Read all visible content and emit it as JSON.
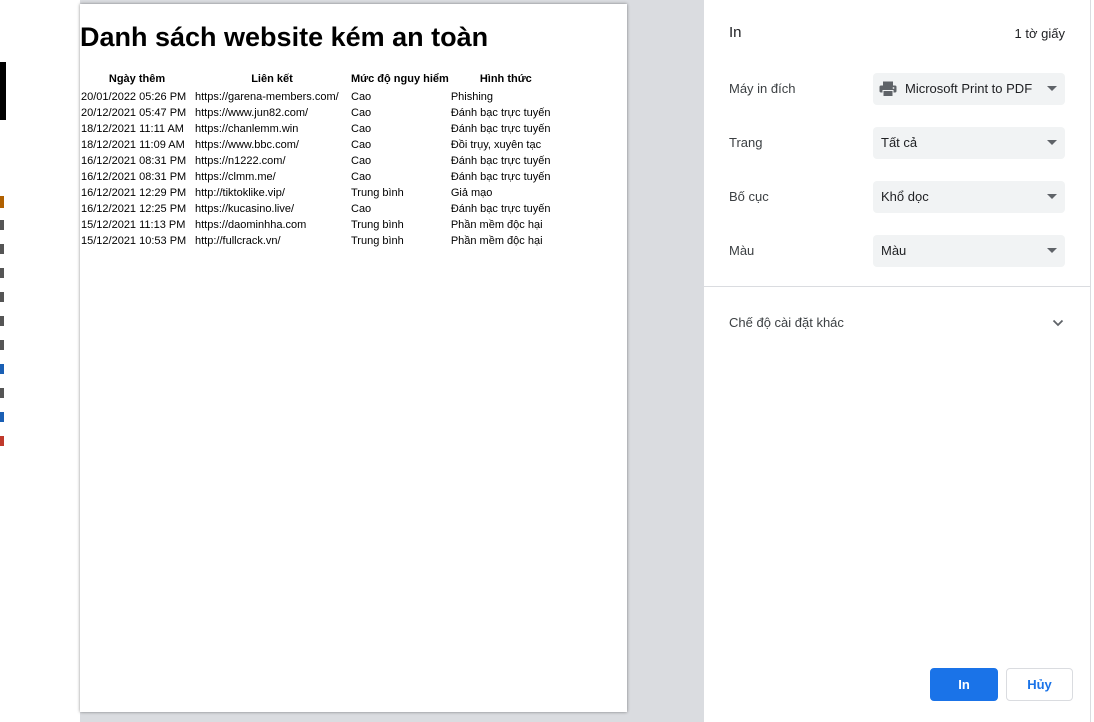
{
  "document": {
    "title": "Danh sách website kém an toàn",
    "table": {
      "headers": [
        "Ngày thêm",
        "Liên kết",
        "Mức độ nguy hiểm",
        "Hình thức"
      ],
      "rows": [
        [
          "20/01/2022 05:26 PM",
          "https://garena-members.com/",
          "Cao",
          "Phishing"
        ],
        [
          "20/12/2021 05:47 PM",
          "https://www.jun82.com/",
          "Cao",
          "Đánh bạc trực tuyến"
        ],
        [
          "18/12/2021 11:11 AM",
          "https://chanlemm.win",
          "Cao",
          "Đánh bạc trực tuyến"
        ],
        [
          "18/12/2021 11:09 AM",
          "https://www.bbc.com/",
          "Cao",
          "Đồi trụy, xuyên tạc"
        ],
        [
          "16/12/2021 08:31 PM",
          "https://n1222.com/",
          "Cao",
          "Đánh bạc trực tuyến"
        ],
        [
          "16/12/2021 08:31 PM",
          "https://clmm.me/",
          "Cao",
          "Đánh bạc trực tuyến"
        ],
        [
          "16/12/2021 12:29 PM",
          "http://tiktoklike.vip/",
          "Trung bình",
          "Giả mạo"
        ],
        [
          "16/12/2021 12:25 PM",
          "https://kucasino.live/",
          "Cao",
          "Đánh bạc trực tuyến"
        ],
        [
          "15/12/2021 11:13 PM",
          "https://daominhha.com",
          "Trung bình",
          "Phần mềm độc hại"
        ],
        [
          "15/12/2021 10:53 PM",
          "http://fullcrack.vn/",
          "Trung bình",
          "Phần mềm độc hại"
        ]
      ]
    }
  },
  "print_dialog": {
    "title": "In",
    "sheet_count": "1 tờ giấy",
    "destination": {
      "label": "Máy in đích",
      "value": "Microsoft Print to PDF",
      "icon": "printer-icon"
    },
    "pages": {
      "label": "Trang",
      "value": "Tất cả"
    },
    "layout": {
      "label": "Bố cục",
      "value": "Khổ dọc"
    },
    "color": {
      "label": "Màu",
      "value": "Màu"
    },
    "more_settings": {
      "label": "Chế độ cài đặt khác",
      "icon": "chevron-down-icon"
    },
    "print_button": "In",
    "cancel_button": "Hủy"
  },
  "colors": {
    "accent": "#1a73e8",
    "preview_background": "#dadce0",
    "select_background": "#f1f3f4"
  }
}
